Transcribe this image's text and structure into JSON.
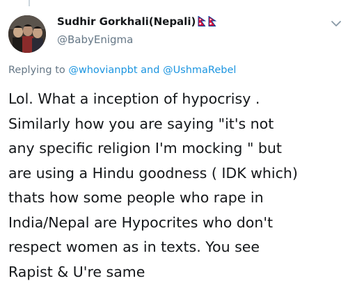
{
  "author": {
    "name": "Sudhir Gorkhali(Nepali)",
    "handle": "@BabyEnigma"
  },
  "icons": {
    "flag": "nepal-flag-icon",
    "menu": "chevron-down-icon"
  },
  "colors": {
    "link": "#1b95e0",
    "secondary_text": "#657786",
    "primary_text": "#14171a",
    "flag_red": "#dc143c",
    "flag_border": "#003893"
  },
  "reply_context": {
    "prefix": "Replying to",
    "user1": "@whovianpbt",
    "conjunction": "and",
    "user2": "@UshmaRebel"
  },
  "tweet": {
    "lines": [
      "Lol. What a inception of hypocrisy .",
      "Similarly how you are saying \"it's not",
      "any specific religion I'm mocking \" but",
      "are using a Hindu goodness ( IDK which)",
      "thats how some people who rape in",
      "India/Nepal are Hypocrites who don't",
      "respect women as in texts. You see",
      "Rapist & U're same"
    ]
  }
}
